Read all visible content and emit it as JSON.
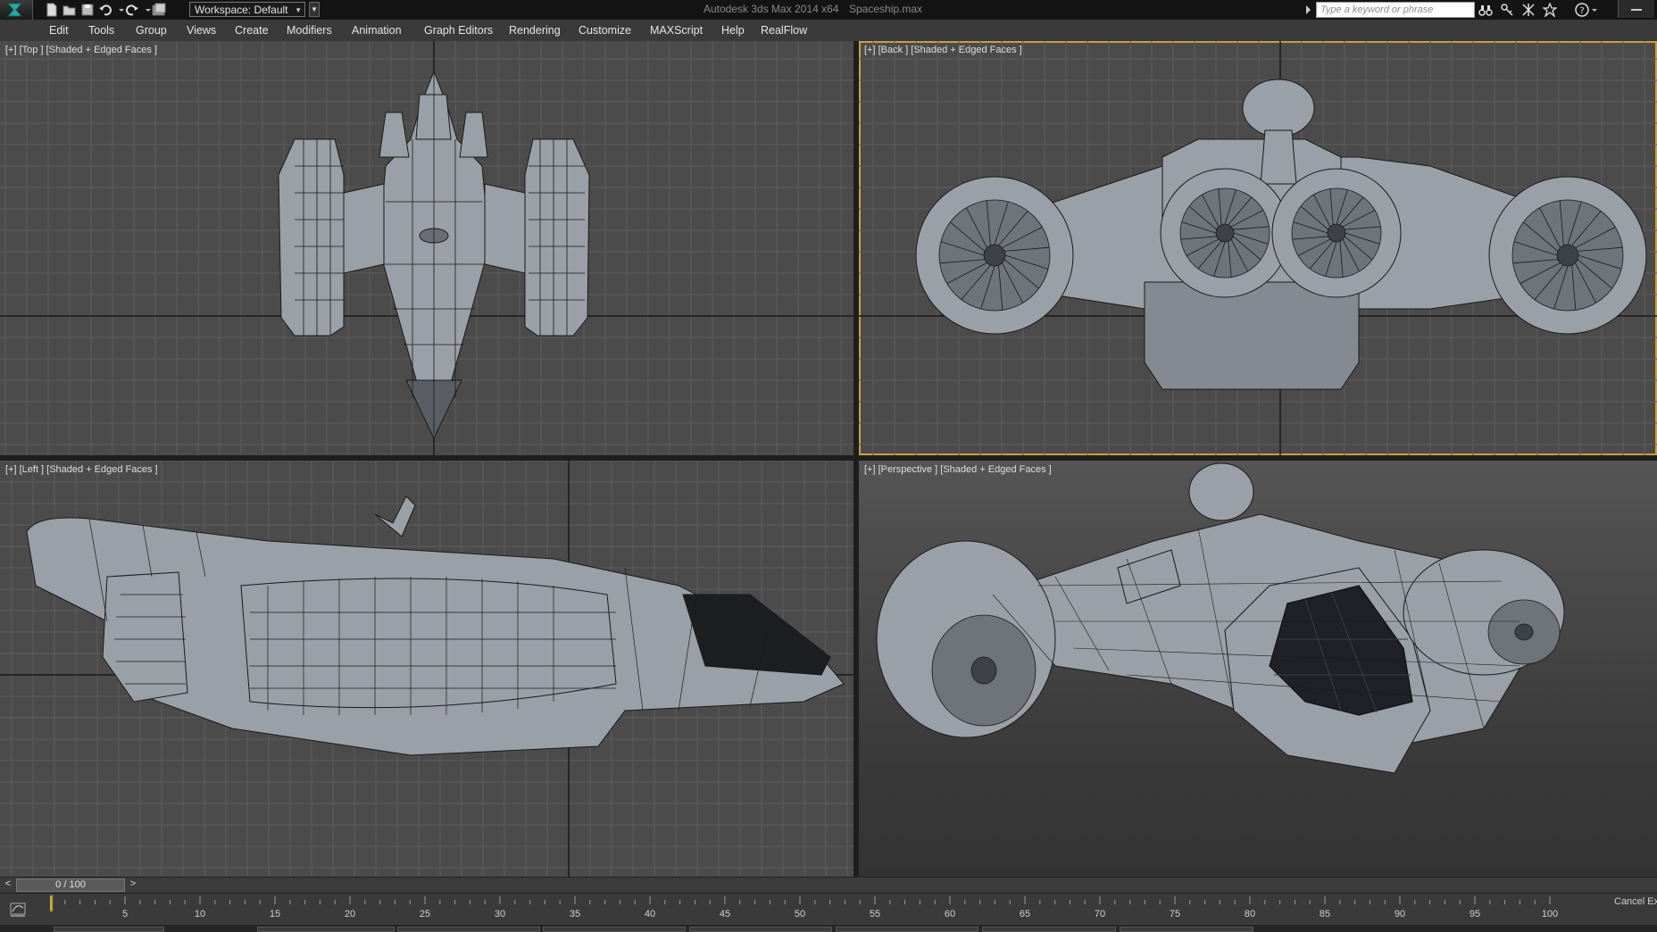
{
  "titlebar": {
    "workspace": "Workspace: Default",
    "app_title": "Autodesk 3ds Max  2014 x64",
    "file_name": "Spaceship.max",
    "search_placeholder": "Type a keyword or phrase",
    "icons": [
      "new-file-icon",
      "open-file-icon",
      "save-icon",
      "undo-icon",
      "redo-icon",
      "project-folder-icon",
      "binoculars-icon",
      "key-icon",
      "communication-icon",
      "star-icon",
      "help-icon"
    ]
  },
  "menu": [
    "Edit",
    "Tools",
    "Group",
    "Views",
    "Create",
    "Modifiers",
    "Animation",
    "Graph Editors",
    "Rendering",
    "Customize",
    "MAXScript",
    "Help",
    "RealFlow"
  ],
  "viewports": {
    "top": {
      "label": "[+] [Top ] [Shaded + Edged Faces ]"
    },
    "back": {
      "label": "[+] [Back ] [Shaded + Edged Faces ]",
      "active": true
    },
    "left": {
      "label": "[+] [Left ] [Shaded + Edged Faces ]"
    },
    "perspective": {
      "label": "[+] [Perspective ] [Shaded + Edged Faces ]"
    }
  },
  "timeslider": {
    "prev": "<",
    "frame": "0 / 100",
    "next": ">",
    "current": 0,
    "total": 100
  },
  "trackbar": {
    "ticks": [
      "5",
      "10",
      "15",
      "20",
      "25",
      "30",
      "35",
      "40",
      "45",
      "50",
      "55",
      "60",
      "65",
      "70",
      "75",
      "80",
      "85",
      "90",
      "95",
      "100"
    ],
    "cancel_label": "Cancel Ex"
  },
  "colors": {
    "active_viewport_border": "#c5a33a",
    "viewport_bg": "#4b4b4b",
    "grid_line": "#5c5c5c",
    "axis_line": "#1a1a1a",
    "model_fill": "#9aa0a8",
    "wire": "#1a1a1a"
  }
}
